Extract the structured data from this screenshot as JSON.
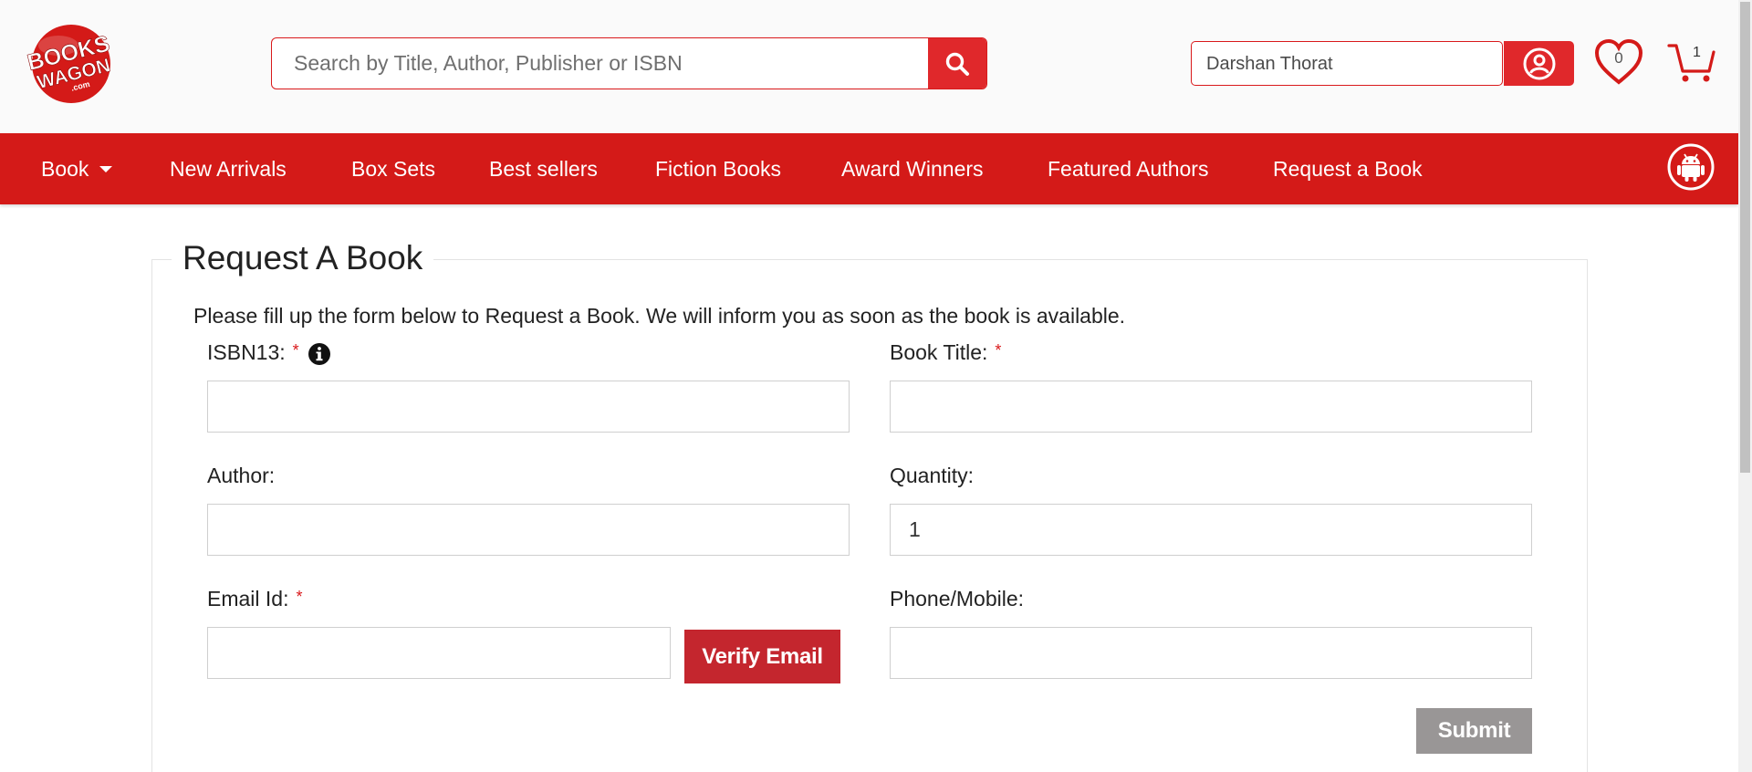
{
  "brand": {
    "logo_icon": "bookswagon-logo",
    "logo_text_line1": "BOOKS",
    "logo_text_line2": "WAGON",
    "logo_text_line3": ".com",
    "color": "#d41a18"
  },
  "header": {
    "search": {
      "placeholder": "Search by Title, Author, Publisher or ISBN",
      "value": "",
      "icon": "search-icon"
    },
    "user": {
      "name": "Darshan Thorat",
      "icon": "user-icon"
    },
    "wishlist": {
      "count": "0",
      "icon": "heart-icon"
    },
    "cart": {
      "count": "1",
      "icon": "cart-icon"
    }
  },
  "nav": {
    "items": [
      {
        "label": "Book"
      },
      {
        "label": "New Arrivals"
      },
      {
        "label": "Box Sets"
      },
      {
        "label": "Best sellers"
      },
      {
        "label": "Fiction Books"
      },
      {
        "label": "Award Winners"
      },
      {
        "label": "Featured Authors"
      },
      {
        "label": "Request a Book"
      }
    ],
    "app_icon": "android-icon"
  },
  "form": {
    "title": "Request A Book",
    "intro": "Please fill up the form below to Request a Book. We will inform you as soon as the book is available.",
    "required_mark": "*",
    "fields": {
      "isbn": {
        "label": "ISBN13:",
        "value": ""
      },
      "book_title": {
        "label": "Book Title:",
        "value": ""
      },
      "author": {
        "label": "Author:",
        "value": ""
      },
      "quantity": {
        "label": "Quantity:",
        "value": "1"
      },
      "email": {
        "label": "Email Id:",
        "value": ""
      },
      "phone": {
        "label": "Phone/Mobile:",
        "value": ""
      }
    },
    "verify_label": "Verify Email",
    "submit_label": "Submit"
  }
}
